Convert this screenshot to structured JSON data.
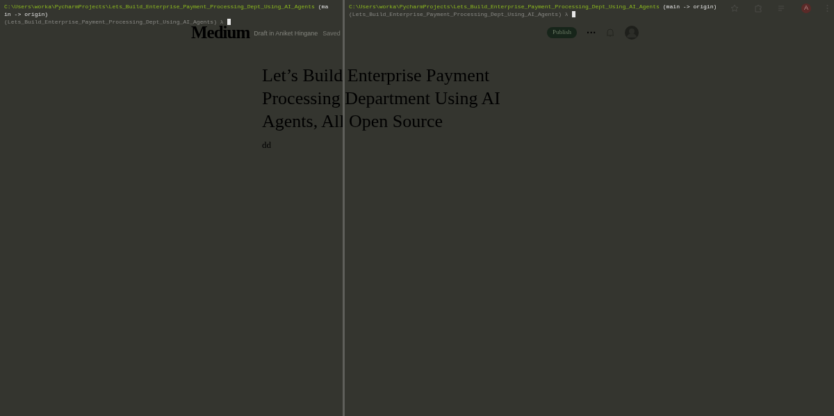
{
  "browser_toolbar": {
    "avatar": "A"
  },
  "background_page": {
    "logo": "Medium",
    "draft_label": "Draft in Aniket Hingane",
    "save_state": "Saved",
    "publish_button": "Publish",
    "more_button": "···",
    "title": "Let’s Build Enterprise Payment Processing Department Using AI Agents, All Open Source",
    "body": "dd"
  },
  "terminal_panes": [
    {
      "lines": [
        [
          {
            "kind": "path",
            "text": "C:\\Users\\worka\\PycharmProjects\\Lets_Build_Enterprise_Payment_Processing_Dept_Using_AI_Agents"
          },
          {
            "kind": "branch",
            "text": " (ma"
          }
        ],
        [
          {
            "kind": "branch",
            "text": "in -> origin)"
          }
        ],
        [
          {
            "kind": "prompt",
            "text": "(Lets_Build_Enterprise_Payment_Processing_Dept_Using_AI_Agents) λ"
          },
          {
            "kind": "cursor"
          }
        ]
      ]
    },
    {
      "lines": [
        [
          {
            "kind": "path",
            "text": "C:\\Users\\worka\\PycharmProjects\\Lets_Build_Enterprise_Payment_Processing_Dept_Using_AI_Agents"
          },
          {
            "kind": "branch",
            "text": " (main -> origin)"
          }
        ],
        [
          {
            "kind": "prompt",
            "text": "(Lets_Build_Enterprise_Payment_Processing_Dept_Using_AI_Agents) λ"
          },
          {
            "kind": "cursor"
          }
        ]
      ]
    }
  ]
}
